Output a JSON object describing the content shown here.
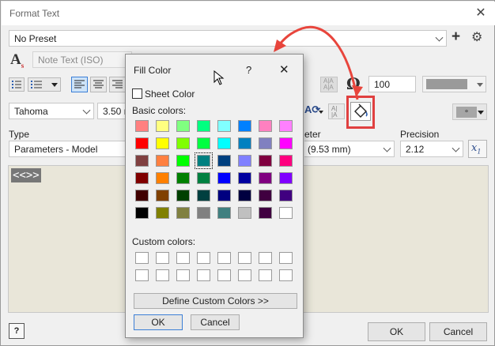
{
  "window": {
    "title": "Format Text",
    "close_glyph": "✕"
  },
  "preset": {
    "value": "No Preset",
    "add_glyph": "+",
    "gear_glyph": "⚙"
  },
  "style": {
    "value": "Note Text (ISO)"
  },
  "zoom": {
    "value": "100"
  },
  "font": {
    "family": "Tahoma",
    "size": "3.50 m"
  },
  "type": {
    "label": "Type",
    "value": "Parameters - Model"
  },
  "parameter": {
    "label": "eter",
    "value": "(9.53 mm)"
  },
  "precision": {
    "label": "Precision",
    "value": "2.12"
  },
  "color_box": {
    "value": "∘"
  },
  "editor": {
    "token": "<<>>"
  },
  "footer": {
    "ok": "OK",
    "cancel": "Cancel",
    "help_glyph": "?"
  },
  "dialog": {
    "title": "Fill Color",
    "help": "?",
    "close": "✕",
    "sheet_color": "Sheet Color",
    "basic_label": "Basic colors:",
    "custom_label": "Custom colors:",
    "define": "Define Custom Colors >>",
    "ok": "OK",
    "cancel": "Cancel",
    "basic_colors": [
      [
        "#ff8080",
        "#ffff80",
        "#80ff80",
        "#00ff80",
        "#80ffff",
        "#0080ff",
        "#ff80c0",
        "#ff80ff"
      ],
      [
        "#ff0000",
        "#ffff00",
        "#80ff00",
        "#00ff40",
        "#00ffff",
        "#0080c0",
        "#8080c0",
        "#ff00ff"
      ],
      [
        "#804040",
        "#ff8040",
        "#00ff00",
        "#008080",
        "#004080",
        "#8080ff",
        "#800040",
        "#ff0080"
      ],
      [
        "#800000",
        "#ff8000",
        "#008000",
        "#008040",
        "#0000ff",
        "#0000a0",
        "#800080",
        "#8000ff"
      ],
      [
        "#400000",
        "#804000",
        "#004000",
        "#004040",
        "#000080",
        "#000040",
        "#400040",
        "#400080"
      ],
      [
        "#000000",
        "#808000",
        "#808040",
        "#808080",
        "#408080",
        "#c0c0c0",
        "#400040",
        "#ffffff"
      ]
    ],
    "selected": [
      2,
      3
    ]
  },
  "colors": {
    "highlight": "#e04040",
    "arrow": "#e8453c",
    "ok_border": "#3c7fd6"
  }
}
